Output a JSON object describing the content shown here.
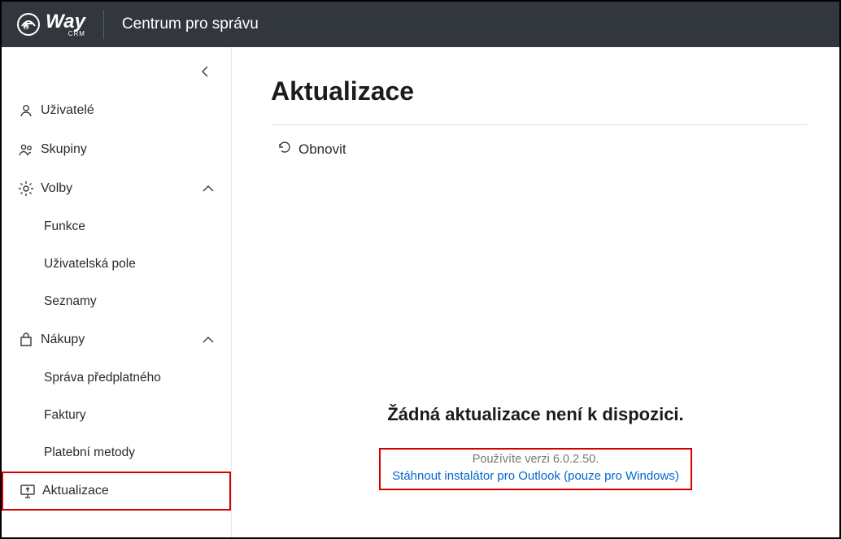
{
  "header": {
    "brand_main": "Way",
    "brand_sub": "CRM",
    "title": "Centrum pro správu"
  },
  "sidebar": {
    "items": {
      "users": "Uživatelé",
      "groups": "Skupiny",
      "options": "Volby",
      "features": "Funkce",
      "userfields": "Uživatelská pole",
      "lists": "Seznamy",
      "purchases": "Nákupy",
      "subscription": "Správa předplatného",
      "invoices": "Faktury",
      "payment": "Platební metody",
      "updates": "Aktualizace"
    }
  },
  "main": {
    "title": "Aktualizace",
    "refresh": "Obnovit",
    "status_title": "Žádná aktualizace není k dispozici.",
    "version_line": "Používíte verzi 6.0.2.50.",
    "download_link": "Stáhnout instalátor pro Outlook (pouze pro Windows)"
  }
}
